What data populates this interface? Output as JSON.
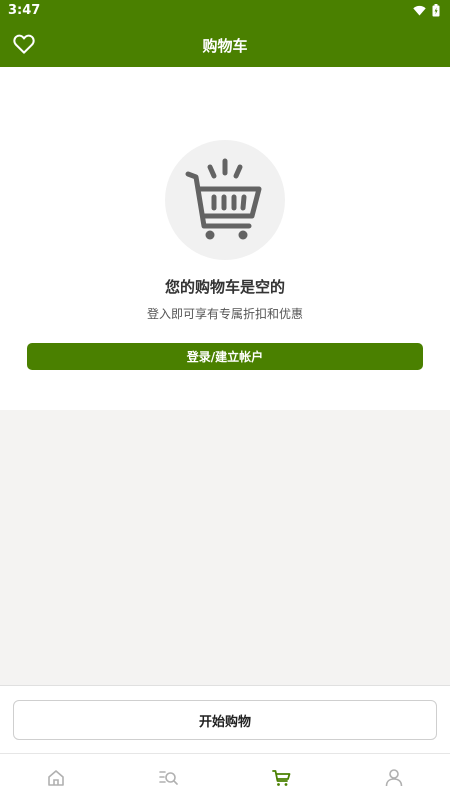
{
  "status_bar": {
    "time": "3:47",
    "icons": [
      "wifi-icon",
      "battery-icon"
    ]
  },
  "header": {
    "title": "购物车",
    "left_icon": "heart-icon"
  },
  "empty_state": {
    "icon": "shopping-cart-icon",
    "title": "您的购物车是空的",
    "subtitle": "登入即可享有专属折扣和优惠",
    "login_button": "登录/建立帐户"
  },
  "bottom": {
    "start_shopping_button": "开始购物"
  },
  "nav": [
    {
      "name": "home",
      "icon": "home-icon",
      "active": false
    },
    {
      "name": "search",
      "icon": "search-list-icon",
      "active": false
    },
    {
      "name": "cart",
      "icon": "cart-icon",
      "active": true
    },
    {
      "name": "account",
      "icon": "user-icon",
      "active": false
    }
  ],
  "colors": {
    "primary": "#4a8000",
    "inactive_icon": "#b0b0b0",
    "background": "#f4f3f2"
  }
}
